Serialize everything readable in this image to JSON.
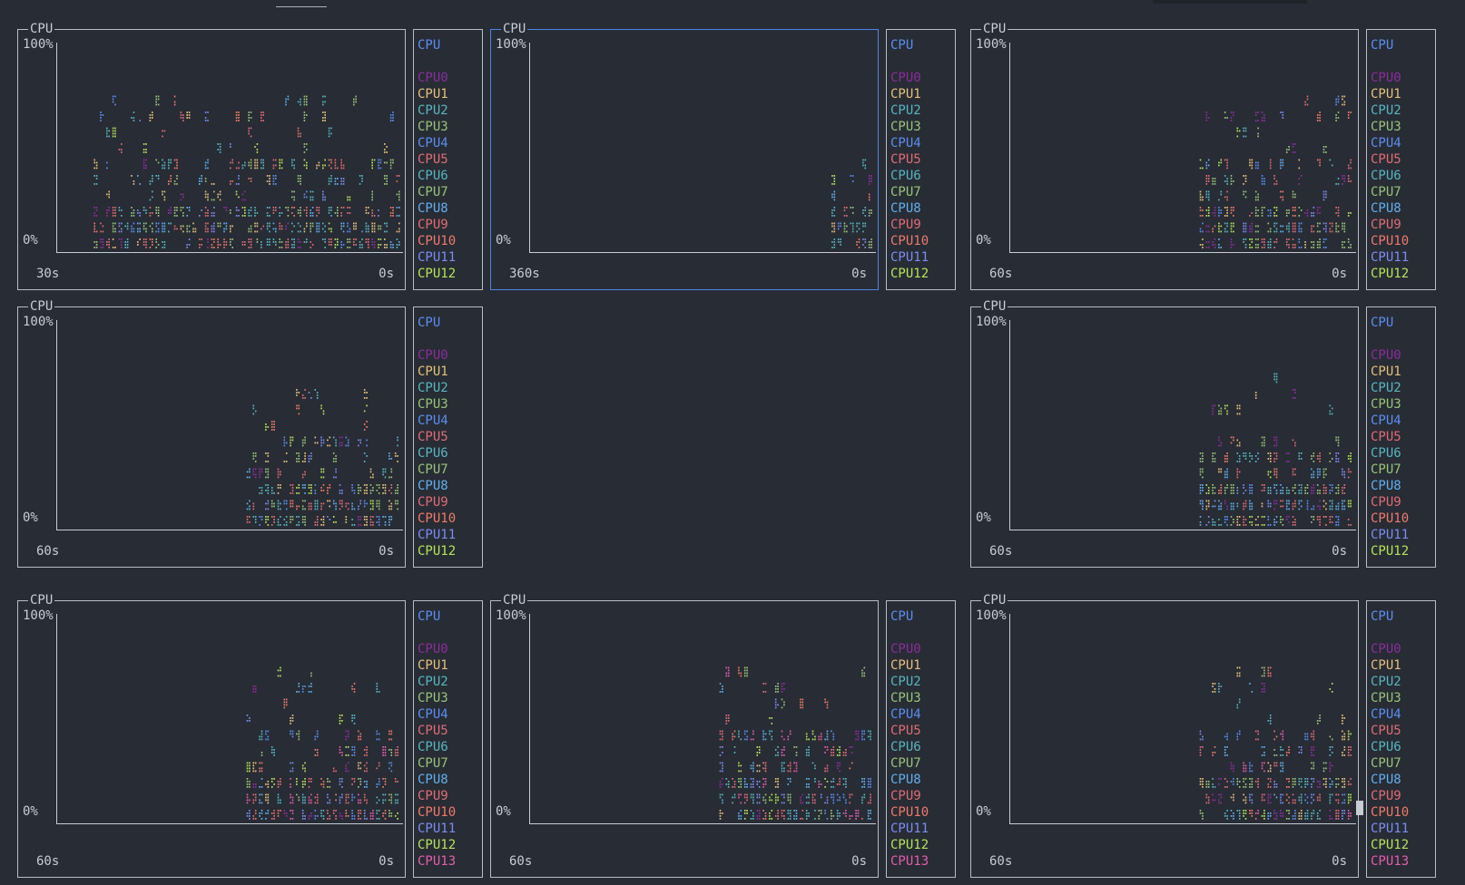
{
  "panel_title": "CPU",
  "y_axis": {
    "top": "100%",
    "bottom": "0%"
  },
  "x_axis_right": "0s",
  "legend_header": "CPU",
  "legend_header_color": "#5a8ef2",
  "series": [
    {
      "name": "CPU0",
      "color": "#8b2d9e"
    },
    {
      "name": "CPU1",
      "color": "#e5c07b"
    },
    {
      "name": "CPU2",
      "color": "#56b6c2"
    },
    {
      "name": "CPU3",
      "color": "#98c379"
    },
    {
      "name": "CPU4",
      "color": "#5a8ef2"
    },
    {
      "name": "CPU5",
      "color": "#e06c75"
    },
    {
      "name": "CPU6",
      "color": "#56b6c2"
    },
    {
      "name": "CPU7",
      "color": "#98c379"
    },
    {
      "name": "CPU8",
      "color": "#61afef"
    },
    {
      "name": "CPU9",
      "color": "#e06c75"
    },
    {
      "name": "CPU10",
      "color": "#ef7a6b"
    },
    {
      "name": "CPU11",
      "color": "#7b8cf2"
    },
    {
      "name": "CPU12",
      "color": "#b5e35a"
    },
    {
      "name": "CPU13",
      "color": "#e35dae"
    }
  ],
  "panels": [
    {
      "id": "r1c1",
      "x_left": "30s",
      "focused": false,
      "cpu_count": 13,
      "start_ratio": 0.1
    },
    {
      "id": "r1c2",
      "x_left": "360s",
      "focused": true,
      "cpu_count": 13,
      "start_ratio": 0.88
    },
    {
      "id": "r1c3",
      "x_left": "60s",
      "focused": false,
      "cpu_count": 13,
      "start_ratio": 0.55
    },
    {
      "id": "r2c1",
      "x_left": "60s",
      "focused": false,
      "cpu_count": 13,
      "start_ratio": 0.55
    },
    {
      "id": "r2c3",
      "x_left": "60s",
      "focused": false,
      "cpu_count": 13,
      "start_ratio": 0.55
    },
    {
      "id": "r3c1",
      "x_left": "60s",
      "focused": false,
      "cpu_count": 14,
      "start_ratio": 0.55
    },
    {
      "id": "r3c2",
      "x_left": "60s",
      "focused": false,
      "cpu_count": 14,
      "start_ratio": 0.55
    },
    {
      "id": "r3c3",
      "x_left": "60s",
      "focused": false,
      "cpu_count": 14,
      "start_ratio": 0.55
    }
  ]
}
